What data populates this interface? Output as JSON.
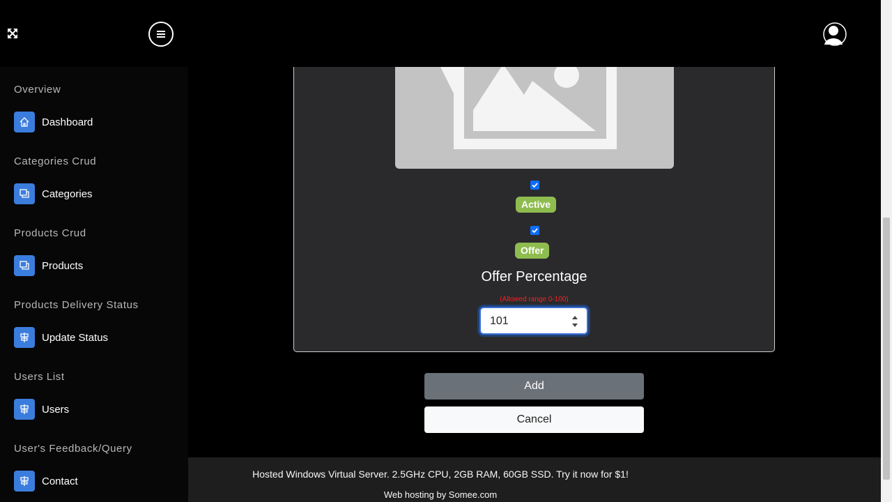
{
  "sidebar": {
    "sections": [
      {
        "title": "Overview",
        "item": {
          "label": "Dashboard",
          "icon": "home-icon"
        }
      },
      {
        "title": "Categories Crud",
        "item": {
          "label": "Categories",
          "icon": "copy-icon"
        }
      },
      {
        "title": "Products Crud",
        "item": {
          "label": "Products",
          "icon": "copy-icon"
        }
      },
      {
        "title": "Products Delivery Status",
        "item": {
          "label": "Update Status",
          "icon": "sign-icon"
        }
      },
      {
        "title": "Users List",
        "item": {
          "label": "Users",
          "icon": "sign-icon"
        }
      },
      {
        "title": "User's Feedback/Query",
        "item": {
          "label": "Contact",
          "icon": "sign-icon"
        }
      }
    ]
  },
  "form": {
    "active_checked": true,
    "active_label": "Active",
    "offer_checked": true,
    "offer_label": "Offer",
    "offer_percentage_label": "Offer Percentage",
    "range_note": "(Allowed range 0-100)",
    "offer_percentage_value": "101",
    "add_label": "Add",
    "cancel_label": "Cancel"
  },
  "ad": {
    "line1": "Hosted Windows Virtual Server. 2.5GHz CPU, 2GB RAM, 60GB SSD. Try it now for $1!",
    "line2": "Web hosting by Somee.com"
  },
  "colors": {
    "accent": "#3b7ddd",
    "badge": "#8fbc4f",
    "error": "#ff1f1f"
  }
}
